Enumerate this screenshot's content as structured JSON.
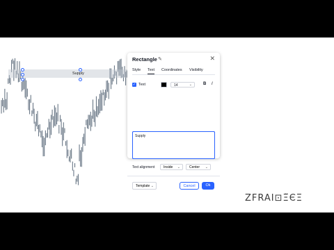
{
  "drawing": {
    "label": "Supply"
  },
  "dialog": {
    "title": "Rectangle",
    "close_icon": "close-icon",
    "edit_icon": "pencil-icon",
    "tabs": [
      {
        "label": "Style",
        "active": false
      },
      {
        "label": "Text",
        "active": true
      },
      {
        "label": "Coordinates",
        "active": false
      },
      {
        "label": "Visibility",
        "active": false
      }
    ],
    "text_toggle_label": "Text",
    "text_toggle_checked": true,
    "text_color": "#000000",
    "font_size": "14",
    "bold_label": "B",
    "italic_label": "I",
    "text_value": "Supply",
    "alignment_label": "Text alignment",
    "vertical_alignment": "Inside",
    "horizontal_alignment": "Center",
    "template_label": "Template",
    "cancel_label": "Cancel",
    "ok_label": "Ok"
  },
  "watermark": {
    "text": "ZFRAI⊡Ξ̈ЄΞ̄"
  },
  "colors": {
    "accent": "#2962ff",
    "candle": "#5b6a7a"
  }
}
